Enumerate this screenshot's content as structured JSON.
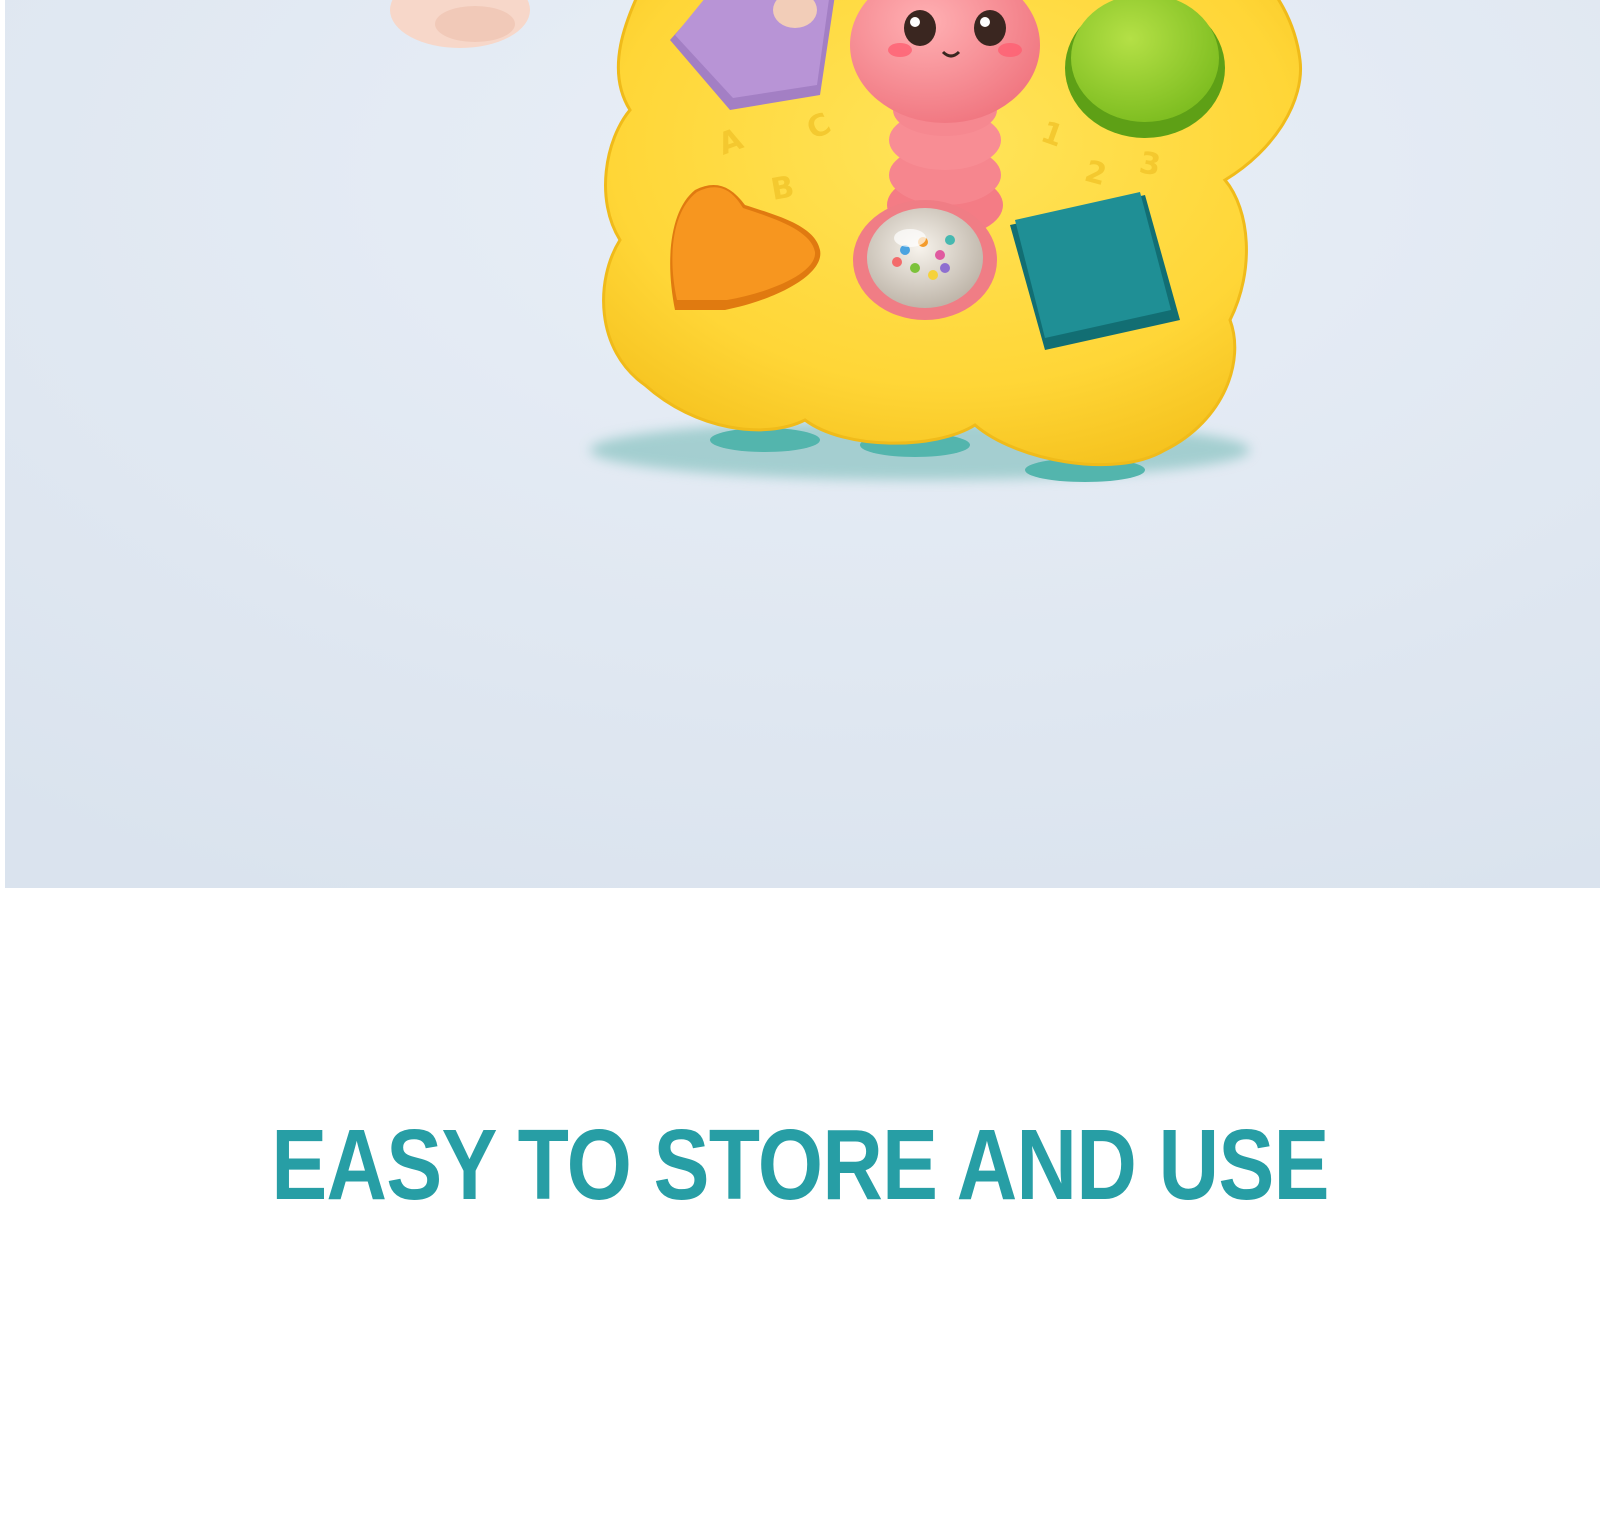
{
  "headline": {
    "text": "EASY TO STORE AND USE",
    "color": "#279ea5"
  },
  "photo": {
    "background_color": "#dfe7f1",
    "toy_color": "#ffd93a",
    "caterpillar_color": "#f4828a",
    "shape_pieces": [
      {
        "shape": "pentagon",
        "color": "#b58fd0"
      },
      {
        "shape": "circle",
        "color": "#8fcc2c"
      },
      {
        "shape": "heart",
        "color": "#f79a26"
      },
      {
        "shape": "rattle-ball",
        "color": "#e8e2d8"
      },
      {
        "shape": "square",
        "color": "#1f8f95"
      }
    ],
    "embossed_letters": [
      "A",
      "B",
      "C",
      "1",
      "2",
      "3"
    ]
  }
}
